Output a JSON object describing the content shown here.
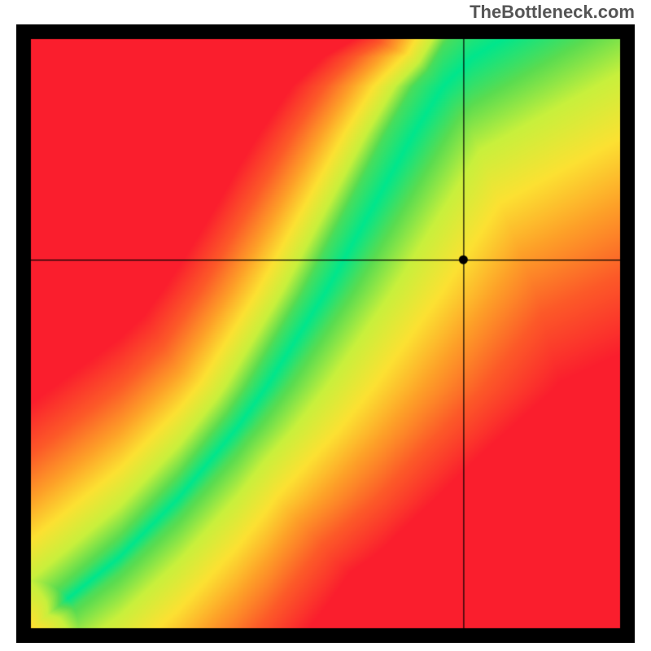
{
  "watermark": "TheBottleneck.com",
  "chart_data": {
    "type": "heatmap",
    "title": "",
    "xlabel": "",
    "ylabel": "",
    "xlim": [
      0,
      1
    ],
    "ylim": [
      0,
      1
    ],
    "colorscale_description": "red→orange→yellow→green→cyan gradient; green/cyan ridge along optimal curve, fading to red at extremes",
    "ridge_curve_x": [
      0.0,
      0.05,
      0.1,
      0.15,
      0.2,
      0.25,
      0.3,
      0.35,
      0.4,
      0.45,
      0.5,
      0.55,
      0.6,
      0.65,
      0.7,
      0.75,
      0.8
    ],
    "ridge_curve_y": [
      0.0,
      0.04,
      0.08,
      0.12,
      0.17,
      0.22,
      0.28,
      0.34,
      0.41,
      0.49,
      0.57,
      0.66,
      0.75,
      0.84,
      0.92,
      0.97,
      1.0
    ],
    "crosshair": {
      "x": 0.735,
      "y": 0.625
    },
    "marker": {
      "x": 0.735,
      "y": 0.625
    },
    "border_color": "#000000",
    "border_thickness_px": 18
  }
}
